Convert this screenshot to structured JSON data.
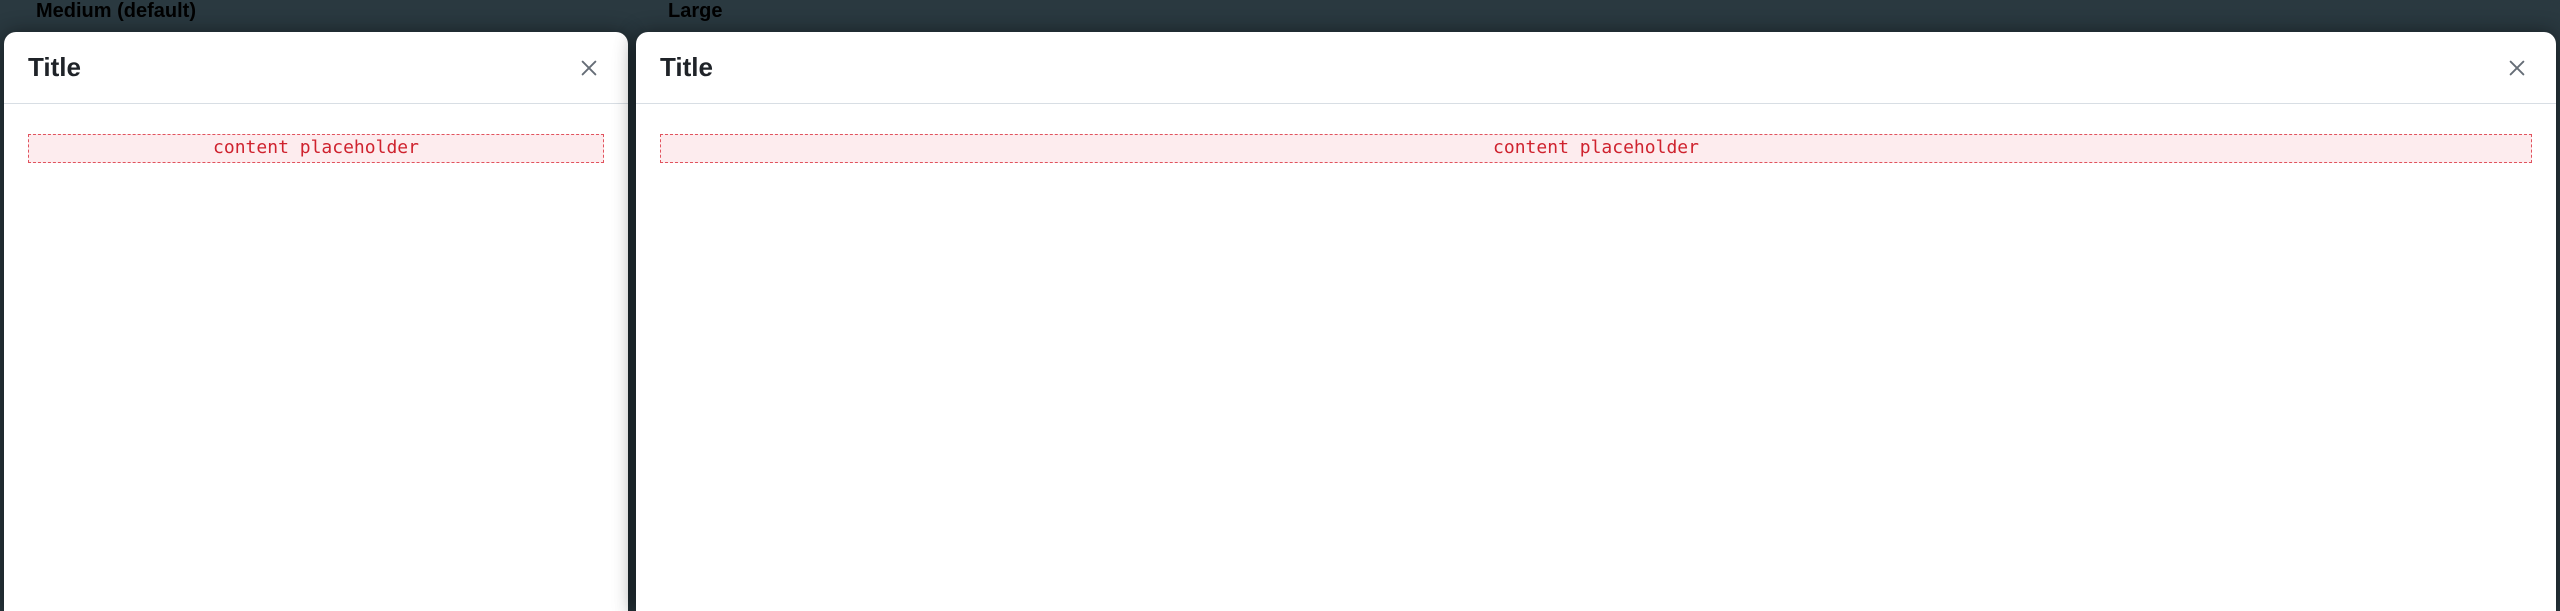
{
  "variants": {
    "medium": {
      "label": "Medium (default)",
      "title": "Title",
      "placeholder": "content placeholder"
    },
    "large": {
      "label": "Large",
      "title": "Title",
      "placeholder": "content placeholder"
    }
  }
}
